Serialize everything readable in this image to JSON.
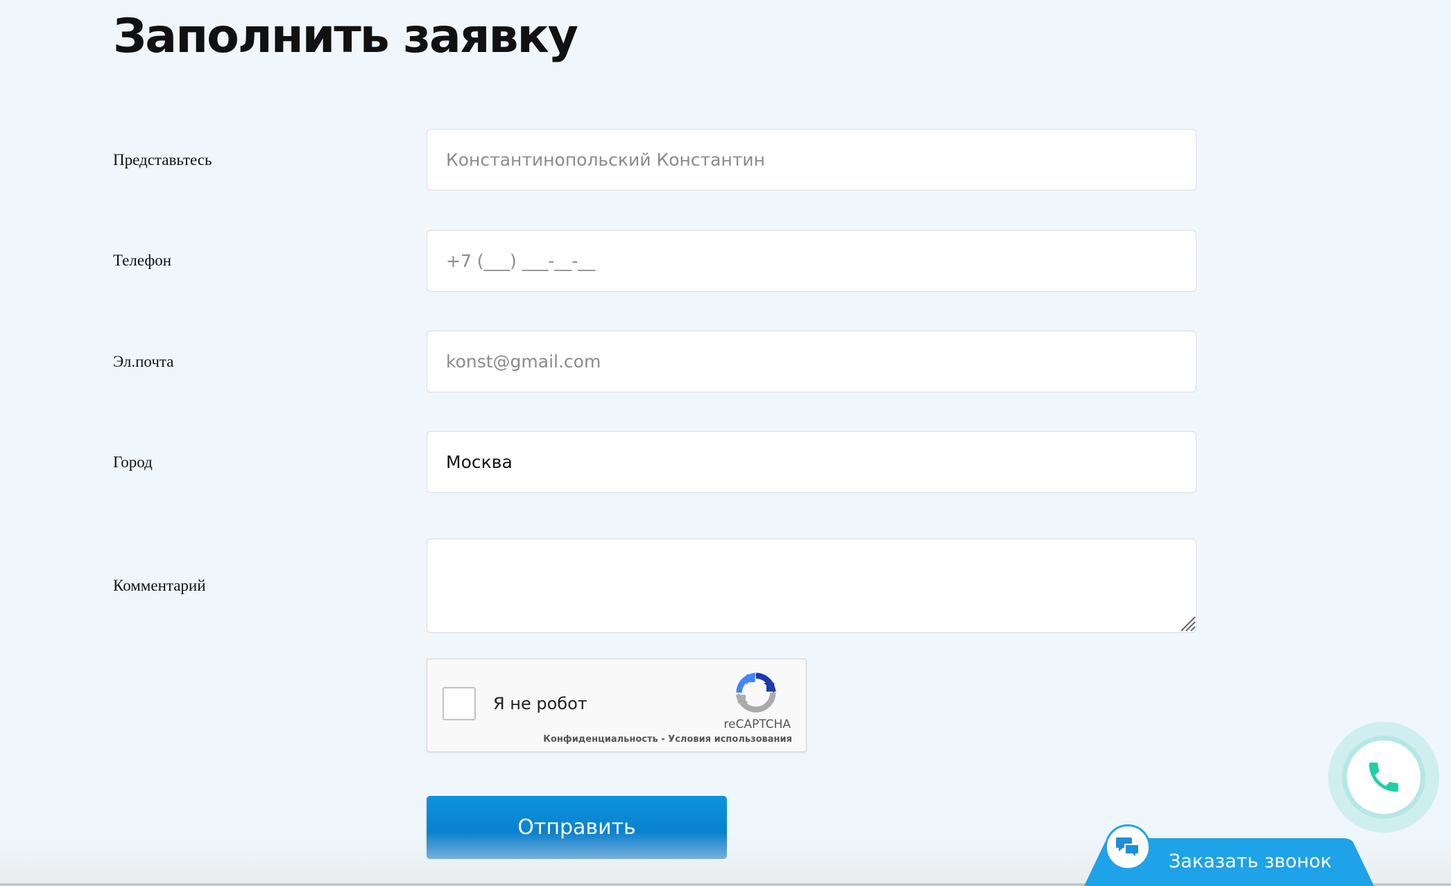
{
  "page": {
    "title": "Заполнить заявку"
  },
  "form": {
    "name": {
      "label": "Представьтесь",
      "placeholder": "Константинопольский Константин",
      "value": ""
    },
    "phone": {
      "label": "Телефон",
      "placeholder": "+7 (___) ___-__-__",
      "value": ""
    },
    "email": {
      "label": "Эл.почта",
      "placeholder": "konst@gmail.com",
      "value": ""
    },
    "city": {
      "label": "Город",
      "placeholder": "",
      "value": "Москва"
    },
    "comment": {
      "label": "Комментарий",
      "placeholder": "",
      "value": ""
    },
    "submit_label": "Отправить"
  },
  "recaptcha": {
    "checkbox_label": "Я не робот",
    "brand": "reCAPTCHA",
    "privacy_link": "Конфиденциальность",
    "separator": " - ",
    "terms_link": "Условия использования",
    "checked": false
  },
  "widgets": {
    "callback_label": "Заказать звонок",
    "call_icon": "phone-icon",
    "chat_icon": "chat-bubbles-icon"
  },
  "colors": {
    "background": "#eff7fd",
    "submit": "#0a84d0",
    "callback_tab": "#1ea2e8",
    "phone_icon": "#1ed1a3"
  }
}
